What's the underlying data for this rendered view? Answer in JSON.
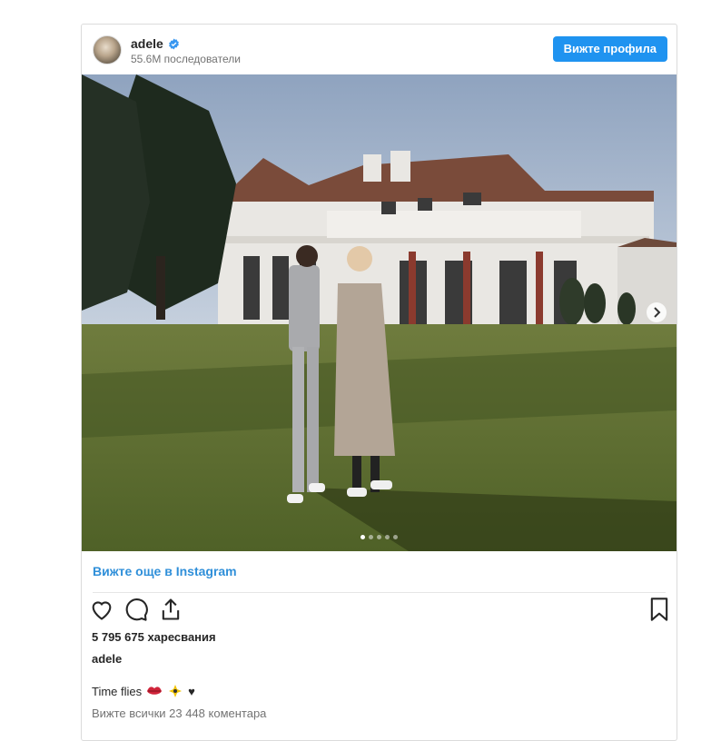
{
  "header": {
    "username": "adele",
    "followers": "55.6M последователи",
    "view_profile_label": "Вижте профила"
  },
  "post": {
    "more_on_instagram": "Вижте още в Instagram",
    "likes": "5 795 675 харесвания",
    "author": "adele",
    "caption": "Time flies",
    "caption_emojis": [
      "lips-emoji",
      "sparkle-bee-emoji",
      "heart-emoji"
    ],
    "comments_link": "Вижте всички 23 448 коментара",
    "carousel": {
      "total_slides": 5,
      "active_slide": 1
    }
  },
  "icons": [
    "verified-badge-icon",
    "like-heart-icon",
    "comment-icon",
    "share-icon",
    "save-bookmark-icon",
    "carousel-next-icon"
  ],
  "colors": {
    "accent": "#1f93f0",
    "link": "#2f8fd9",
    "verified": "#3897f0"
  }
}
